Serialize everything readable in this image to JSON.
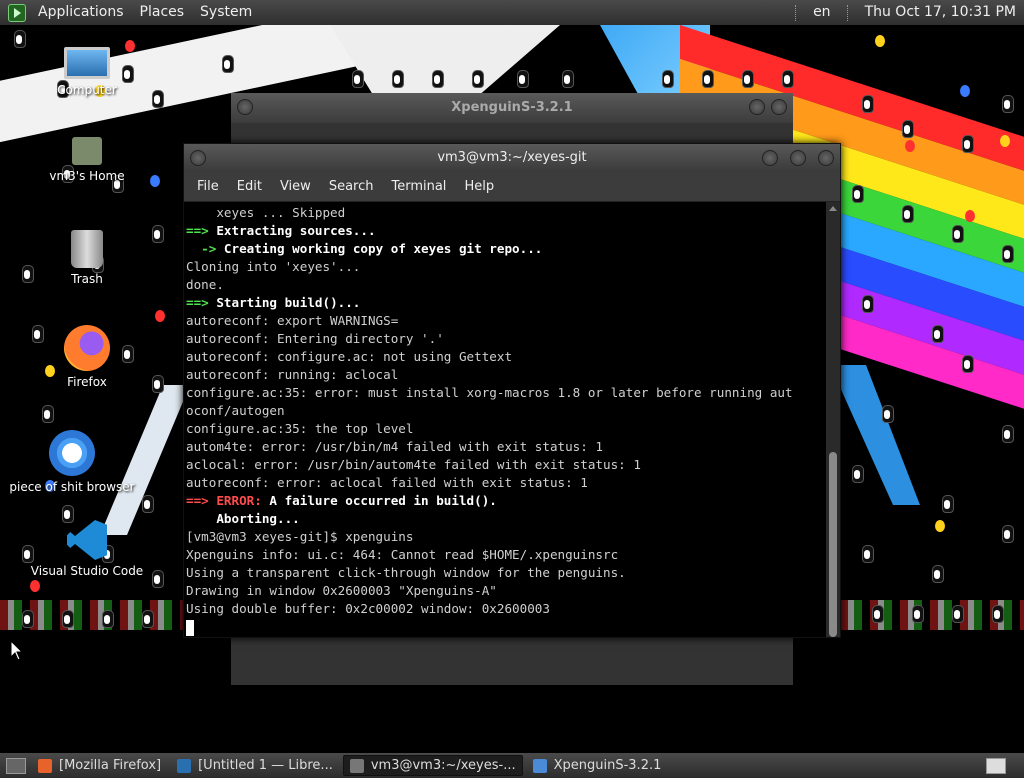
{
  "top_panel": {
    "menus": [
      "Applications",
      "Places",
      "System"
    ],
    "keyboard_layout": "en",
    "clock": "Thu Oct 17, 10:31 PM"
  },
  "desktop_icons": [
    {
      "label": "Computer",
      "icon": "computer-icon"
    },
    {
      "label": "vm3's Home",
      "icon": "home-folder-icon"
    },
    {
      "label": "Trash",
      "icon": "trash-icon"
    },
    {
      "label": "Firefox",
      "icon": "firefox-icon"
    },
    {
      "label": "piece of shit browser",
      "icon": "chrome-icon"
    },
    {
      "label": "Visual Studio Code",
      "icon": "vscode-icon"
    }
  ],
  "xpenguins_window": {
    "title": "XpenguinS-3.2.1"
  },
  "terminal": {
    "title": "vm3@vm3:~/xeyes-git",
    "menus": [
      "File",
      "Edit",
      "View",
      "Search",
      "Terminal",
      "Help"
    ],
    "lines": [
      [
        {
          "t": "    xeyes ... Skipped"
        }
      ],
      [
        {
          "t": "==>",
          "c": "green"
        },
        {
          "t": " Extracting sources...",
          "c": "white"
        }
      ],
      [
        {
          "t": "  ->",
          "c": "green"
        },
        {
          "t": " Creating working copy of xeyes git repo...",
          "c": "white"
        }
      ],
      [
        {
          "t": "Cloning into 'xeyes'..."
        }
      ],
      [
        {
          "t": "done."
        }
      ],
      [
        {
          "t": "==>",
          "c": "green"
        },
        {
          "t": " Starting build()...",
          "c": "white"
        }
      ],
      [
        {
          "t": "autoreconf: export WARNINGS="
        }
      ],
      [
        {
          "t": "autoreconf: Entering directory '.'"
        }
      ],
      [
        {
          "t": "autoreconf: configure.ac: not using Gettext"
        }
      ],
      [
        {
          "t": "autoreconf: running: aclocal"
        }
      ],
      [
        {
          "t": "configure.ac:35: error: must install xorg-macros 1.8 or later before running aut"
        }
      ],
      [
        {
          "t": "oconf/autogen"
        }
      ],
      [
        {
          "t": "configure.ac:35: the top level"
        }
      ],
      [
        {
          "t": "autom4te: error: /usr/bin/m4 failed with exit status: 1"
        }
      ],
      [
        {
          "t": "aclocal: error: /usr/bin/autom4te failed with exit status: 1"
        }
      ],
      [
        {
          "t": "autoreconf: error: aclocal failed with exit status: 1"
        }
      ],
      [
        {
          "t": "==> ERROR:",
          "c": "red"
        },
        {
          "t": " A failure occurred in build().",
          "c": "white"
        }
      ],
      [
        {
          "t": "    Aborting...",
          "c": "white"
        }
      ],
      [
        {
          "t": "[vm3@vm3 xeyes-git]$ xpenguins"
        }
      ],
      [
        {
          "t": "Xpenguins info: ui.c: 464: Cannot read $HOME/.xpenguinsrc"
        }
      ],
      [
        {
          "t": "Using a transparent click-through window for the penguins."
        }
      ],
      [
        {
          "t": "Drawing in window 0x2600003 \"Xpenguins-A\""
        }
      ],
      [
        {
          "t": "Using double buffer: 0x2c00002 window: 0x2600003"
        }
      ]
    ]
  },
  "taskbar": {
    "tasks": [
      {
        "label": "[Mozilla Firefox]",
        "icon": "firefox-icon",
        "color": "#e8632b",
        "active": false
      },
      {
        "label": "[Untitled 1 — Libre...",
        "icon": "libreoffice-icon",
        "color": "#2a6fb0",
        "active": false
      },
      {
        "label": "vm3@vm3:~/xeyes-...",
        "icon": "terminal-icon",
        "color": "#777777",
        "active": true
      },
      {
        "label": "XpenguinS-3.2.1",
        "icon": "window-icon",
        "color": "#4a8ad6",
        "active": false
      }
    ]
  },
  "colors": {
    "prompt_green": "#4ee44e",
    "error_red": "#ff4b4b",
    "rainbow": [
      "#ff2a2a",
      "#ff9a1a",
      "#ffe81a",
      "#3ad63a",
      "#2aa8ff",
      "#2a4cff",
      "#b02aff",
      "#ff2ac8"
    ]
  }
}
